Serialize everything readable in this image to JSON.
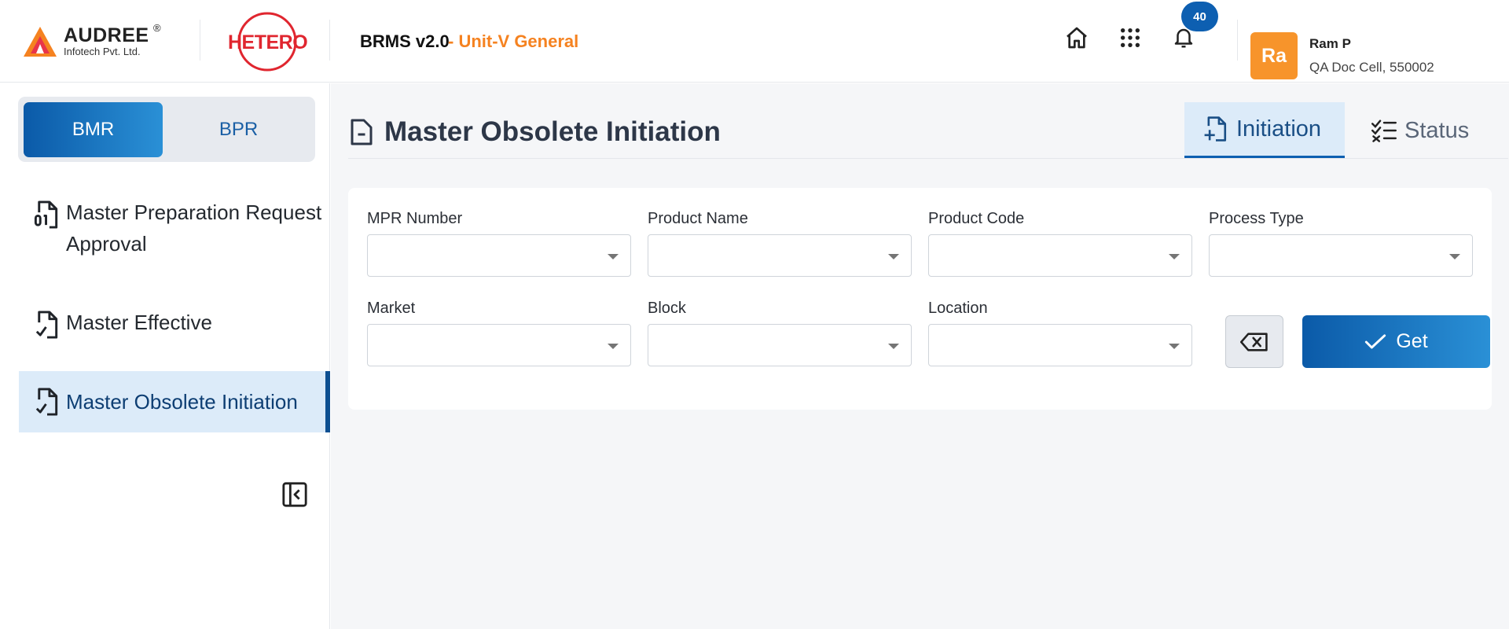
{
  "header": {
    "brand_name": "AUDREE",
    "brand_reg": "®",
    "brand_sub": "Infotech Pvt. Ltd.",
    "partner_logo": "HETERO",
    "app_title": "BRMS v2.0",
    "app_subtitle": "- Unit-V General",
    "notification_count": "40",
    "user": {
      "initials": "Ra",
      "name": "Ram P",
      "role": "QA Doc Cell, 550002"
    },
    "icons": [
      "home-icon",
      "apps-grid-icon",
      "bell-icon"
    ]
  },
  "sidebar": {
    "segments": [
      {
        "label": "BMR",
        "active": true
      },
      {
        "label": "BPR",
        "active": false
      }
    ],
    "items": [
      {
        "label": "Master Preparation Request Approval",
        "icon": "file-binary-icon",
        "active": false
      },
      {
        "label": "Master Effective",
        "icon": "file-check-icon",
        "active": false
      },
      {
        "label": "Master Obsolete Initiation",
        "icon": "file-check-icon",
        "active": true
      }
    ]
  },
  "main": {
    "page_title": "Master Obsolete Initiation",
    "tabs": [
      {
        "label": "Initiation",
        "icon": "file-plus-icon",
        "active": true
      },
      {
        "label": "Status",
        "icon": "checklist-icon",
        "active": false
      }
    ],
    "filters": [
      {
        "label": "MPR Number",
        "value": ""
      },
      {
        "label": "Product Name",
        "value": ""
      },
      {
        "label": "Product Code",
        "value": ""
      },
      {
        "label": "Process Type",
        "value": ""
      },
      {
        "label": "Market",
        "value": ""
      },
      {
        "label": "Block",
        "value": ""
      },
      {
        "label": "Location",
        "value": ""
      }
    ],
    "get_button": "Get"
  },
  "colors": {
    "primary": "#0d5fb1",
    "accent_orange": "#f58220",
    "hetero_red": "#e0262f",
    "active_bg": "#dcebf9"
  }
}
